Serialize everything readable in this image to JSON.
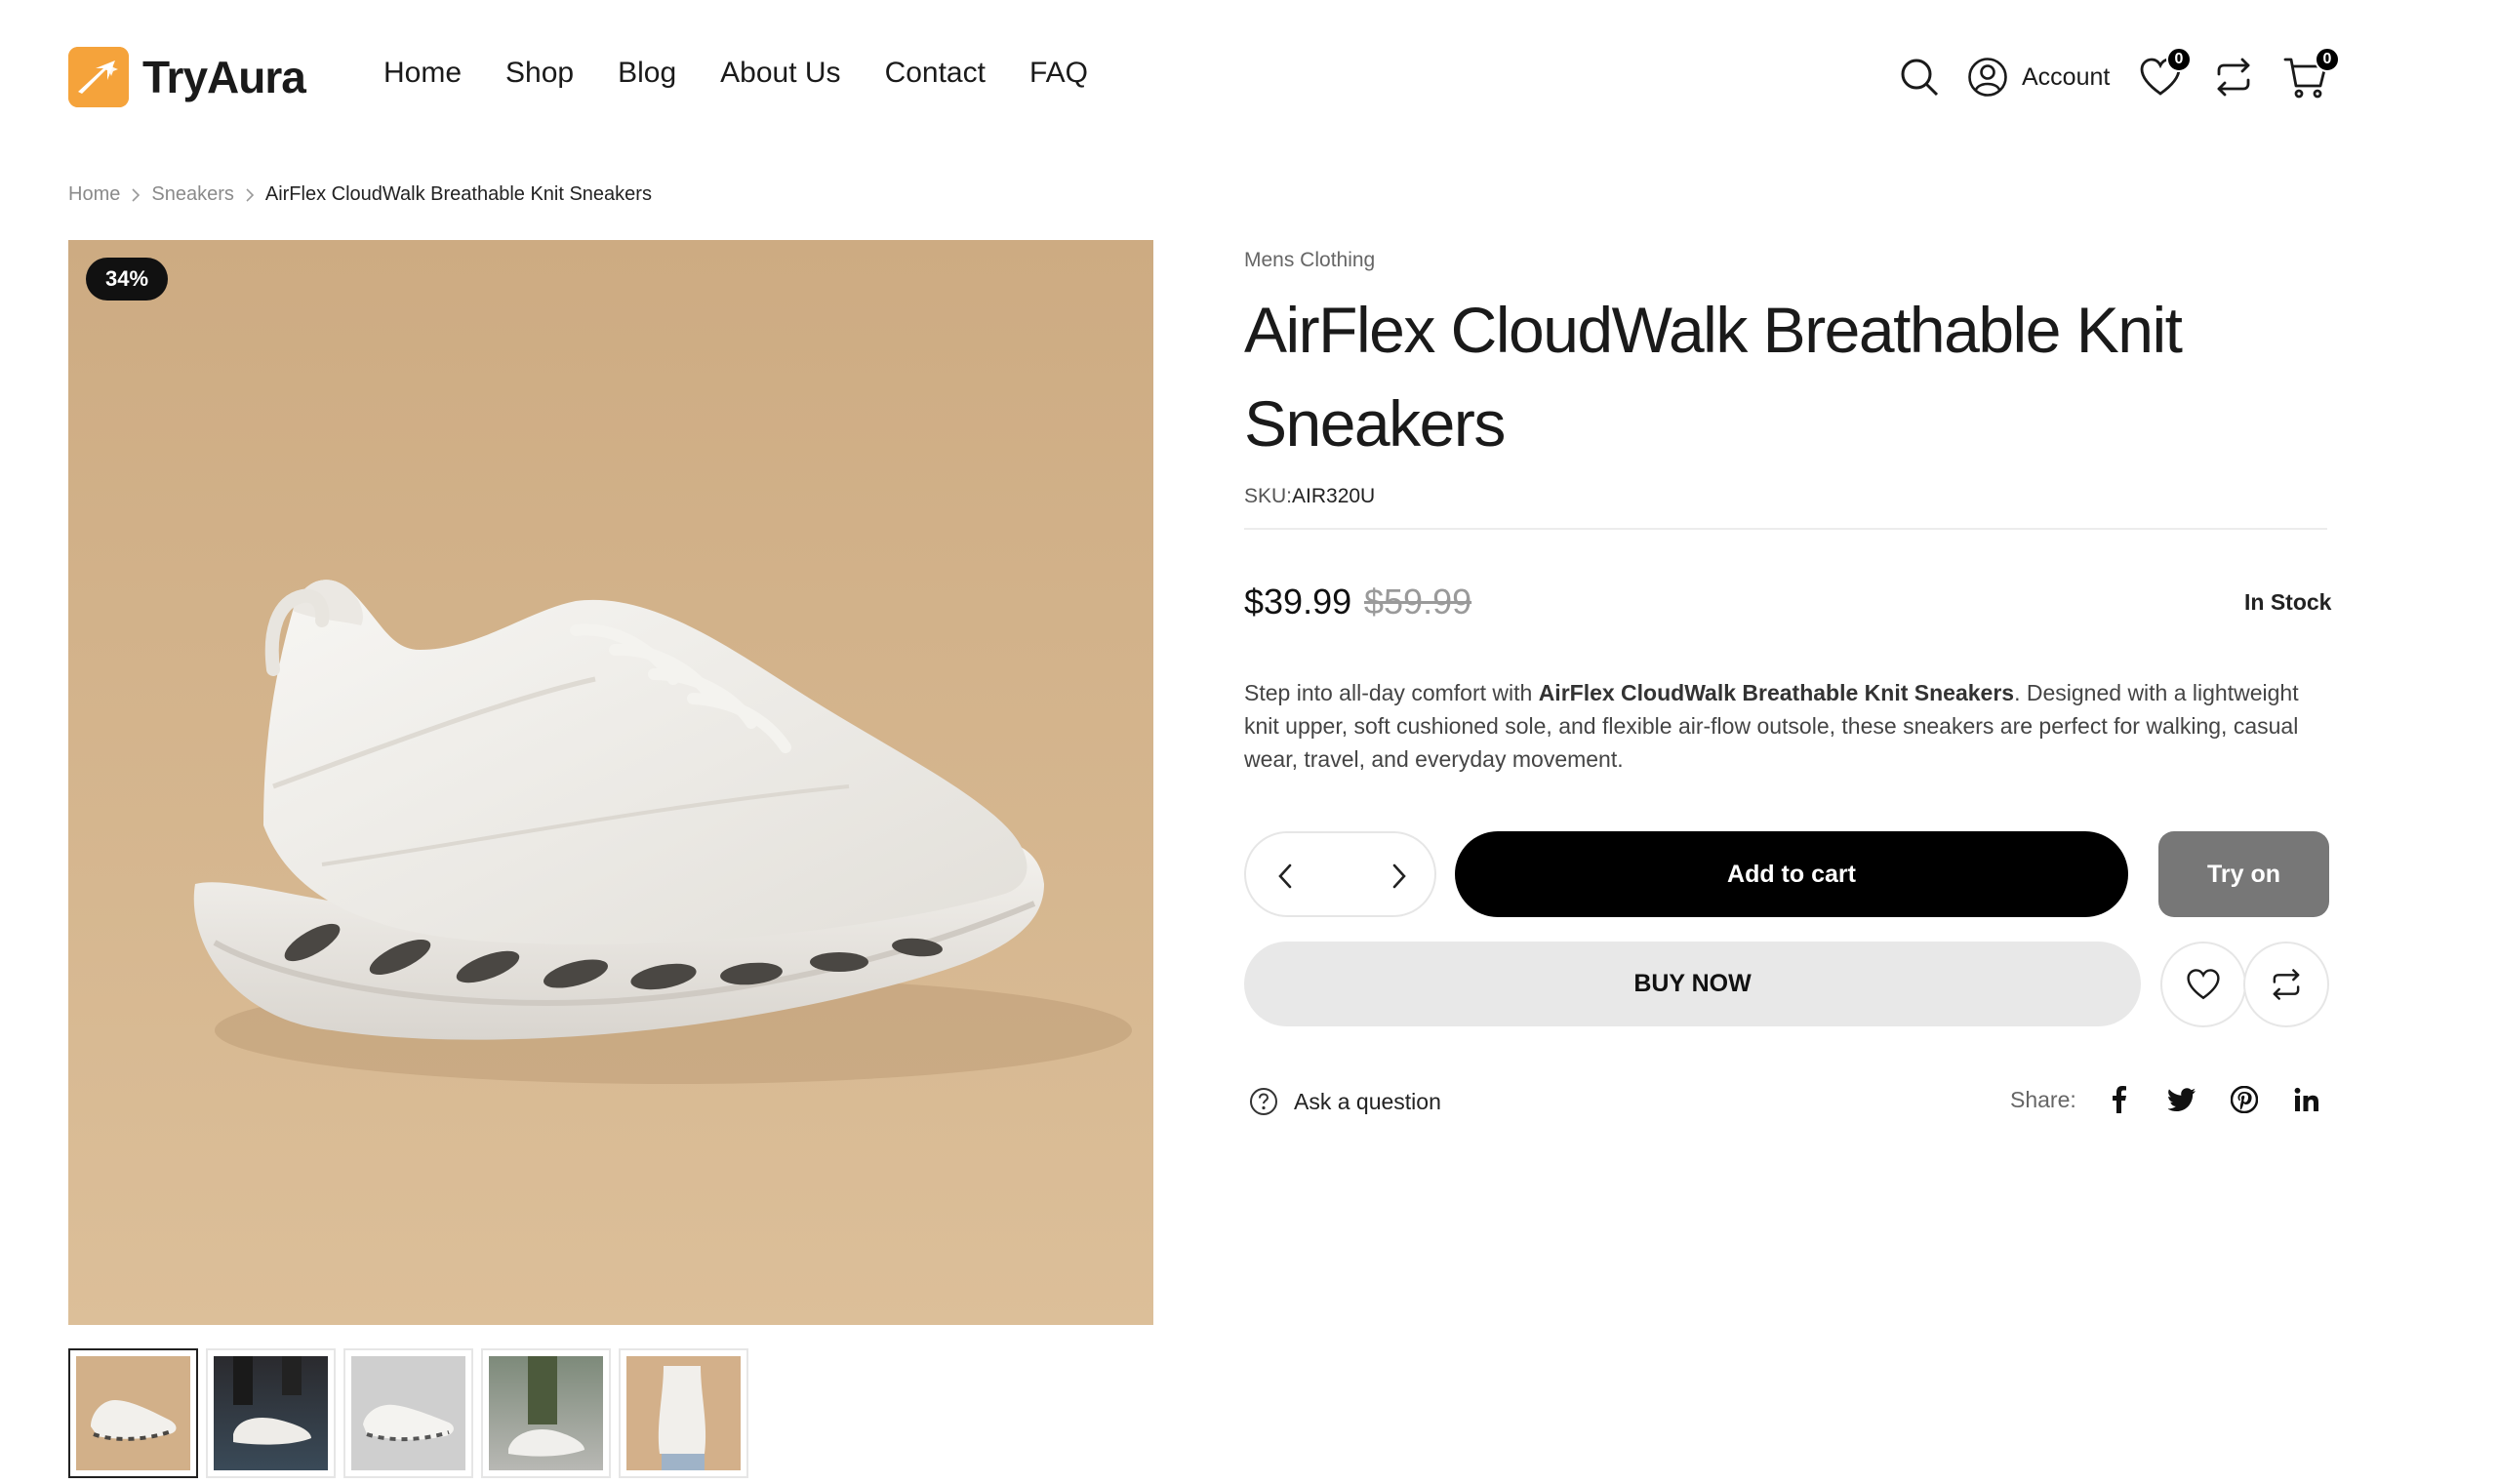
{
  "brand": {
    "name": "TryAura",
    "accent": "#f5a33b"
  },
  "nav": [
    "Home",
    "Shop",
    "Blog",
    "About Us",
    "Contact",
    "FAQ"
  ],
  "header": {
    "account_label": "Account",
    "wishlist_count": "0",
    "cart_count": "0"
  },
  "breadcrumb": [
    "Home",
    "Sneakers",
    "AirFlex CloudWalk Breathable Knit Sneakers"
  ],
  "gallery": {
    "sale_badge": "34%",
    "thumbnail_count": 5,
    "active_thumbnail": 1
  },
  "product": {
    "category": "Mens Clothing",
    "title": "AirFlex CloudWalk Breathable Knit Sneakers",
    "sku_label": "SKU:",
    "sku_value": "AIR320U",
    "price": "$39.99",
    "old_price": "$59.99",
    "stock": "In Stock",
    "desc_before": "Step into all-day comfort with ",
    "desc_bold": "AirFlex CloudWalk Breathable Knit Sneakers",
    "desc_after": ". Designed with a lightweight knit upper, soft cushioned sole, and flexible air-flow outsole, these sneakers are perfect for walking, casual wear, travel, and everyday movement."
  },
  "actions": {
    "add_to_cart": "Add to cart",
    "try_on": "Try on",
    "buy_now": "BUY NOW",
    "ask_question": "Ask a question",
    "share_label": "Share:"
  },
  "icons": {
    "search": "search-icon",
    "account": "user-circle-icon",
    "wishlist": "heart-icon",
    "compare": "compare-icon",
    "cart": "cart-icon",
    "share": [
      "facebook-icon",
      "twitter-icon",
      "pinterest-icon",
      "linkedin-icon"
    ]
  }
}
